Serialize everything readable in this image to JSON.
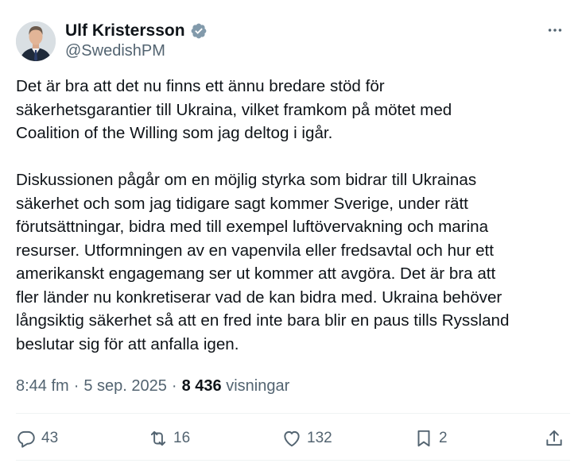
{
  "author": {
    "name": "Ulf Kristersson",
    "handle": "@SwedishPM"
  },
  "tweet": {
    "paragraphs": [
      "Det är bra att det nu finns ett ännu bredare stöd för\nsäkerhetsgarantier till Ukraina, vilket framkom på mötet med\nCoalition of the Willing som jag deltog i igår.",
      "Diskussionen pågår om en möjlig styrka som bidrar till Ukrainas\nsäkerhet och som jag tidigare sagt kommer Sverige, under rätt\nförutsättningar, bidra med till exempel luftövervakning och marina\nresurser. Utformningen av en vapenvila eller fredsavtal och hur ett\namerikanskt engagemang ser ut kommer att avgöra. Det är bra att\nfler länder nu konkretiserar vad de kan bidra med. Ukraina behöver\nlångsiktig säkerhet så att en fred inte bara blir en paus tills Ryssland\nbeslutar sig för att anfalla igen."
    ]
  },
  "meta": {
    "time": "8:44 fm",
    "separator": "·",
    "date": "5 sep. 2025",
    "views_count": "8 436",
    "views_label": "visningar"
  },
  "actions": {
    "replies": "43",
    "reposts": "16",
    "likes": "132",
    "bookmarks": "2"
  },
  "colors": {
    "text": "#0f1419",
    "secondary": "#536471",
    "verified": "#829aab",
    "divider": "#eff3f4"
  },
  "icons": [
    "verified-badge-icon",
    "more-options-icon",
    "reply-icon",
    "repost-icon",
    "like-icon",
    "bookmark-icon",
    "share-icon"
  ]
}
